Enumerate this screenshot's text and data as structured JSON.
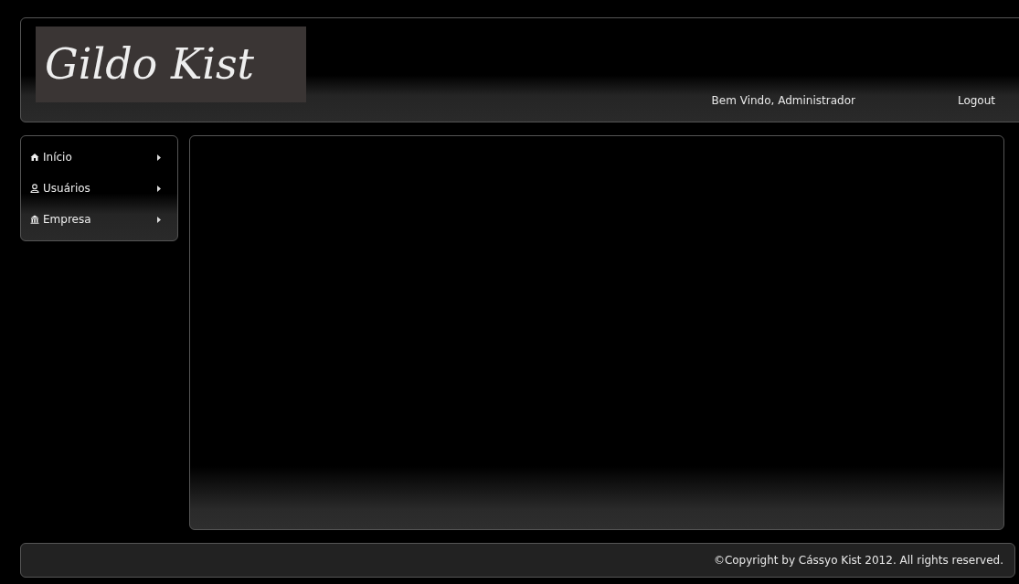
{
  "header": {
    "logo": "Gildo Kist",
    "welcome": "Bem Vindo, Administrador",
    "logout": "Logout"
  },
  "sidebar": {
    "items": [
      {
        "label": "Início"
      },
      {
        "label": "Usuários"
      },
      {
        "label": "Empresa"
      }
    ]
  },
  "footer": {
    "copyright": "©Copyright by Cássyo Kist 2012. All rights reserved."
  }
}
